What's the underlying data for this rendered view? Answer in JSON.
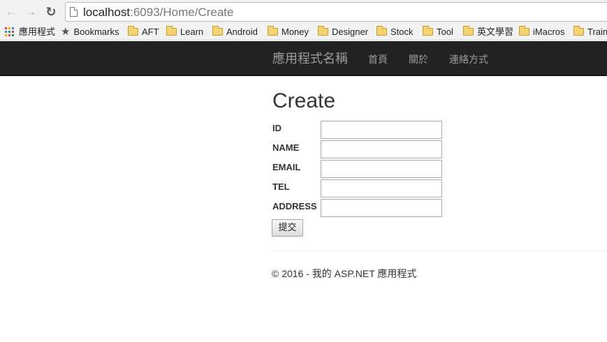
{
  "browser": {
    "url_host": "localhost",
    "url_path": ":6093/Home/Create",
    "bookmarks": [
      {
        "label": "應用程式",
        "icon": "apps-grid-icon"
      },
      {
        "label": "Bookmarks",
        "icon": "star-icon"
      },
      {
        "label": "AFT",
        "icon": "folder-icon"
      },
      {
        "label": "Learn",
        "icon": "folder-icon"
      },
      {
        "label": "Android",
        "icon": "folder-icon"
      },
      {
        "label": "Money",
        "icon": "folder-icon"
      },
      {
        "label": "Designer",
        "icon": "folder-icon"
      },
      {
        "label": "Stock",
        "icon": "folder-icon"
      },
      {
        "label": "Tool",
        "icon": "folder-icon"
      },
      {
        "label": "英文學習",
        "icon": "folder-icon"
      },
      {
        "label": "iMacros",
        "icon": "folder-icon"
      },
      {
        "label": "Train",
        "icon": "folder-icon"
      }
    ]
  },
  "navbar": {
    "brand": "應用程式名稱",
    "links": [
      "首頁",
      "關於",
      "連絡方式"
    ],
    "background": "#222222",
    "link_color": "#9d9d9d"
  },
  "form": {
    "title": "Create",
    "fields": [
      {
        "label": "ID",
        "value": ""
      },
      {
        "label": "NAME",
        "value": ""
      },
      {
        "label": "EMAIL",
        "value": ""
      },
      {
        "label": "TEL",
        "value": ""
      },
      {
        "label": "ADDRESS",
        "value": ""
      }
    ],
    "submit_label": "提交"
  },
  "footer": {
    "text": "© 2016 - 我的 ASP.NET 應用程式"
  }
}
